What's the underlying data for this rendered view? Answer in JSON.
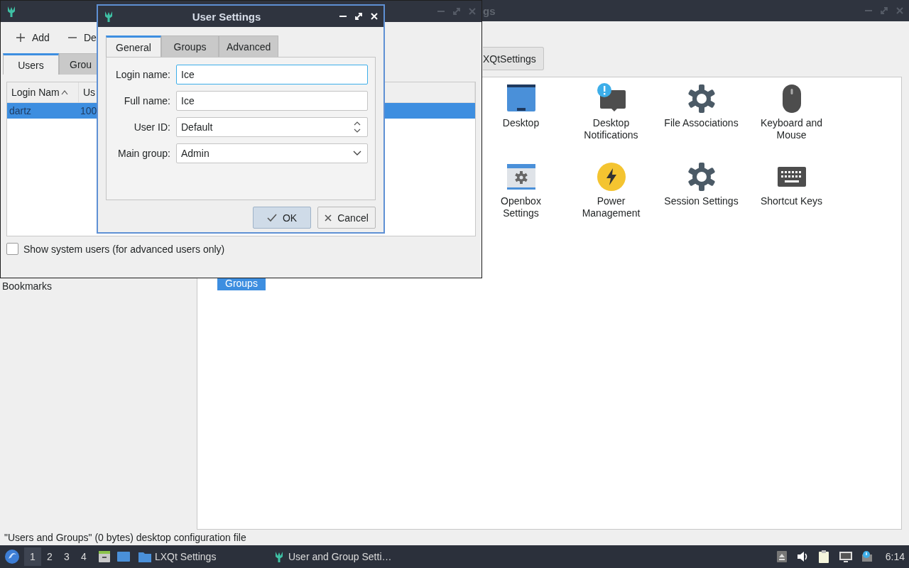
{
  "background_window": {
    "title": "gs",
    "path_button": "XQtSettings",
    "sidebar": {
      "items": [
        {
          "label": "Bookmarks"
        }
      ]
    },
    "section_header": "Groups",
    "items": [
      {
        "label": "Desktop",
        "kind": "desktop"
      },
      {
        "label": "Desktop Notifications",
        "kind": "notifications"
      },
      {
        "label": "File Associations",
        "kind": "gear"
      },
      {
        "label": "Keyboard and Mouse",
        "kind": "mouse"
      },
      {
        "label": "Openbox Settings",
        "kind": "openbox"
      },
      {
        "label": "Power Management",
        "kind": "power"
      },
      {
        "label": "Session Settings",
        "kind": "gear"
      },
      {
        "label": "Shortcut Keys",
        "kind": "keyboard"
      }
    ]
  },
  "users_window": {
    "toolbar": [
      {
        "label": "Add",
        "kind": "add"
      },
      {
        "label": "De",
        "kind": "remove"
      }
    ],
    "tabs": [
      {
        "label": "Users",
        "selected": true
      },
      {
        "label": "Grou",
        "selected": false
      }
    ],
    "table": {
      "columns": [
        {
          "label": "Login Nam"
        },
        {
          "label": "Us"
        }
      ],
      "rows": [
        {
          "cells": [
            "dartz",
            "100"
          ],
          "selected": true
        }
      ]
    },
    "show_system_users": {
      "label": "Show system users (for advanced users only)",
      "checked": false
    }
  },
  "dialog": {
    "title": "User Settings",
    "tabs": [
      {
        "label": "General",
        "selected": true
      },
      {
        "label": "Groups",
        "selected": false
      },
      {
        "label": "Advanced",
        "selected": false
      }
    ],
    "fields": [
      {
        "label": "Login name:",
        "value": "Ice",
        "kind": "text",
        "focused": true
      },
      {
        "label": "Full name:",
        "value": "Ice",
        "kind": "text",
        "focused": false
      },
      {
        "label": "User ID:",
        "value": "Default",
        "kind": "spin",
        "focused": false
      },
      {
        "label": "Main group:",
        "value": "Admin",
        "kind": "combo",
        "focused": false
      }
    ],
    "buttons": [
      {
        "label": "OK",
        "kind": "ok",
        "default": true
      },
      {
        "label": "Cancel",
        "kind": "cancel",
        "default": false
      }
    ]
  },
  "status_bar": "\"Users and Groups\" (0 bytes) desktop configuration file",
  "taskbar": {
    "desktops": [
      {
        "label": "1",
        "selected": true
      },
      {
        "label": "2",
        "selected": false
      },
      {
        "label": "3",
        "selected": false
      },
      {
        "label": "4",
        "selected": false
      }
    ],
    "tasks": [
      {
        "label": "LXQt Settings",
        "kind": "folder"
      },
      {
        "label": "User and Group Setti…",
        "kind": "app"
      }
    ],
    "clock": "6:14"
  }
}
